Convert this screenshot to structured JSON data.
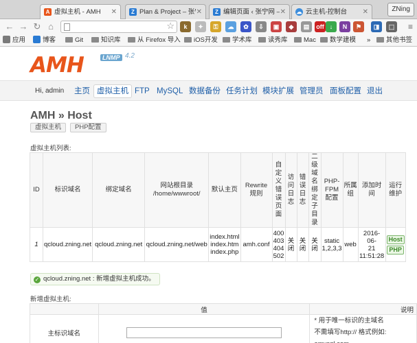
{
  "browser": {
    "tabs": [
      {
        "title": "虚拟主机 - AMH",
        "icon": "amh-icon",
        "active": true
      },
      {
        "title": "Plan & Project – 张宁",
        "icon": "z-icon"
      },
      {
        "title": "编辑页面 ‹ 张宁网 — W",
        "icon": "z-icon"
      },
      {
        "title": "云主机-控制台",
        "icon": "cloud-icon"
      }
    ],
    "profile": "ZNing",
    "url": "",
    "bookmarks": [
      "应用",
      "博客",
      "Git",
      "知识库",
      "从 Firefox 导入",
      "iOS开发",
      "学术库",
      "读秀库",
      "Mac",
      "数学建模",
      "»",
      "其他书签"
    ]
  },
  "amh": {
    "logo": "AMH",
    "logo_sub": "LNMP",
    "version": "4.2",
    "greeting": "Hi, admin",
    "nav": [
      "主页",
      "虚拟主机",
      "FTP",
      "MySQL",
      "数据备份",
      "任务计划",
      "模块扩展",
      "管理员",
      "面板配置",
      "退出"
    ],
    "page_title": "AMH » Host",
    "subtabs": [
      "虚拟主机",
      "PHP配置"
    ],
    "list_label": "虚拟主机列表:",
    "columns": [
      "ID",
      "标识域名",
      "绑定域名",
      "网站根目录 /home/wwwroot/",
      "默认主页",
      "Rewrite 规则",
      "自定义错误页面",
      "访问日志",
      "错误日志",
      "二级域名绑定子目录",
      "PHP-FPM 配置",
      "所属组",
      "添加时间",
      "运行维护"
    ],
    "rows": [
      {
        "id": "1",
        "ident_domain": "qcloud.zning.net",
        "bind_domain": "qcloud.zning.net",
        "root": "qcloud.zning.net/web",
        "index_pages": [
          "index.html",
          "index.htm",
          "index.php"
        ],
        "rewrite": "amh.conf",
        "error_pages": [
          "400",
          "403",
          "404",
          "502"
        ],
        "access_log": "关闭",
        "error_log": "关闭",
        "subdir": "关闭",
        "php_fpm": "static 1,2,3,3",
        "group": "web",
        "added": [
          "2016-06-",
          "21",
          "11:51:28"
        ],
        "ops": [
          "Host",
          "PHP"
        ]
      }
    ],
    "success_msg": "qcloud.zning.net : 新增虚拟主机成功。",
    "add_label": "新增虚拟主机:",
    "form_headers": [
      "值",
      "说明"
    ],
    "form_field": "主标识域名",
    "form_note1": "* 用于唯一标识的主域名",
    "form_note2": "不需填写http:// 格式例如: amysql.com"
  }
}
